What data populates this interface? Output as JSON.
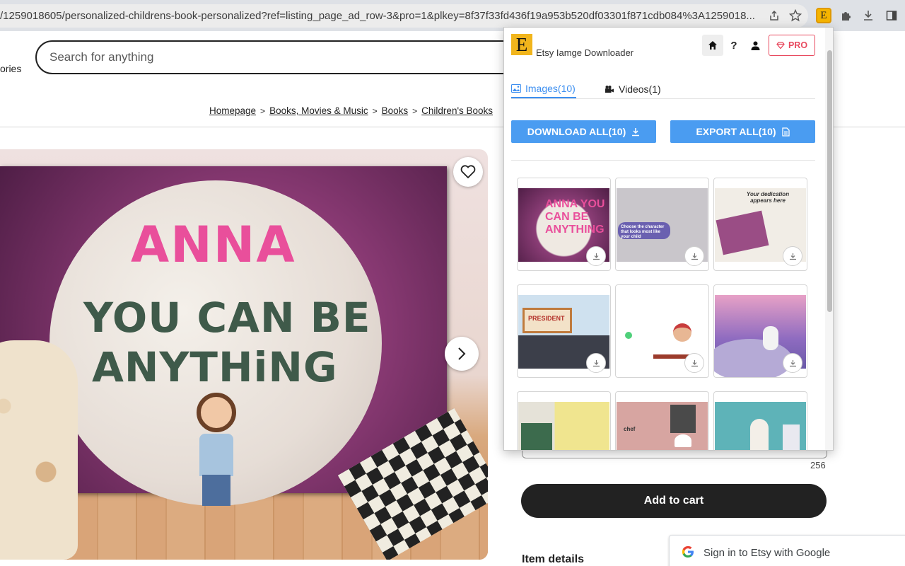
{
  "browser": {
    "url": "/1259018605/personalized-childrens-book-personalized?ref=listing_page_ad_row-3&pro=1&plkey=8f37f33fd436f19a953b520df03301f871cdb084%3A1259018..."
  },
  "header": {
    "categories_fragment": "ories",
    "search_placeholder": "Search for anything"
  },
  "breadcrumb": [
    "Homepage",
    "Books, Movies & Music",
    "Books",
    "Children's Books"
  ],
  "listing": {
    "cover_line1": "ANNA",
    "cover_line2": "YOU CAN BE",
    "cover_line3": "ANYTHiNG",
    "char_count": "256",
    "add_to_cart": "Add to cart",
    "item_details": "Item details"
  },
  "google_signin": {
    "label": "Sign in to Etsy with Google"
  },
  "extension": {
    "logo_letter": "E",
    "title": "Etsy Iamge Downloader",
    "pro_label": "PRO",
    "help_label": "?",
    "tabs": [
      {
        "label": "Images(10)",
        "active": true
      },
      {
        "label": "Videos(1)",
        "active": false
      }
    ],
    "download_all": "DOWNLOAD ALL(10)",
    "export_all": "EXPORT ALL(10)",
    "accent_color": "#4a9cf1",
    "pro_color": "#e84a5f",
    "thumbnails": [
      {
        "id": "thumb-1",
        "caption": "ANNA YOU CAN BE ANYTHING"
      },
      {
        "id": "thumb-2",
        "caption": "Choose the character that looks most like your child"
      },
      {
        "id": "thumb-3",
        "caption": "Your dedication appears here"
      },
      {
        "id": "thumb-4",
        "caption": "PRESIDENT"
      },
      {
        "id": "thumb-5",
        "caption": ""
      },
      {
        "id": "thumb-6",
        "caption": ""
      },
      {
        "id": "thumb-7",
        "caption": ""
      },
      {
        "id": "thumb-8",
        "caption": "chef"
      },
      {
        "id": "thumb-9",
        "caption": ""
      }
    ]
  }
}
